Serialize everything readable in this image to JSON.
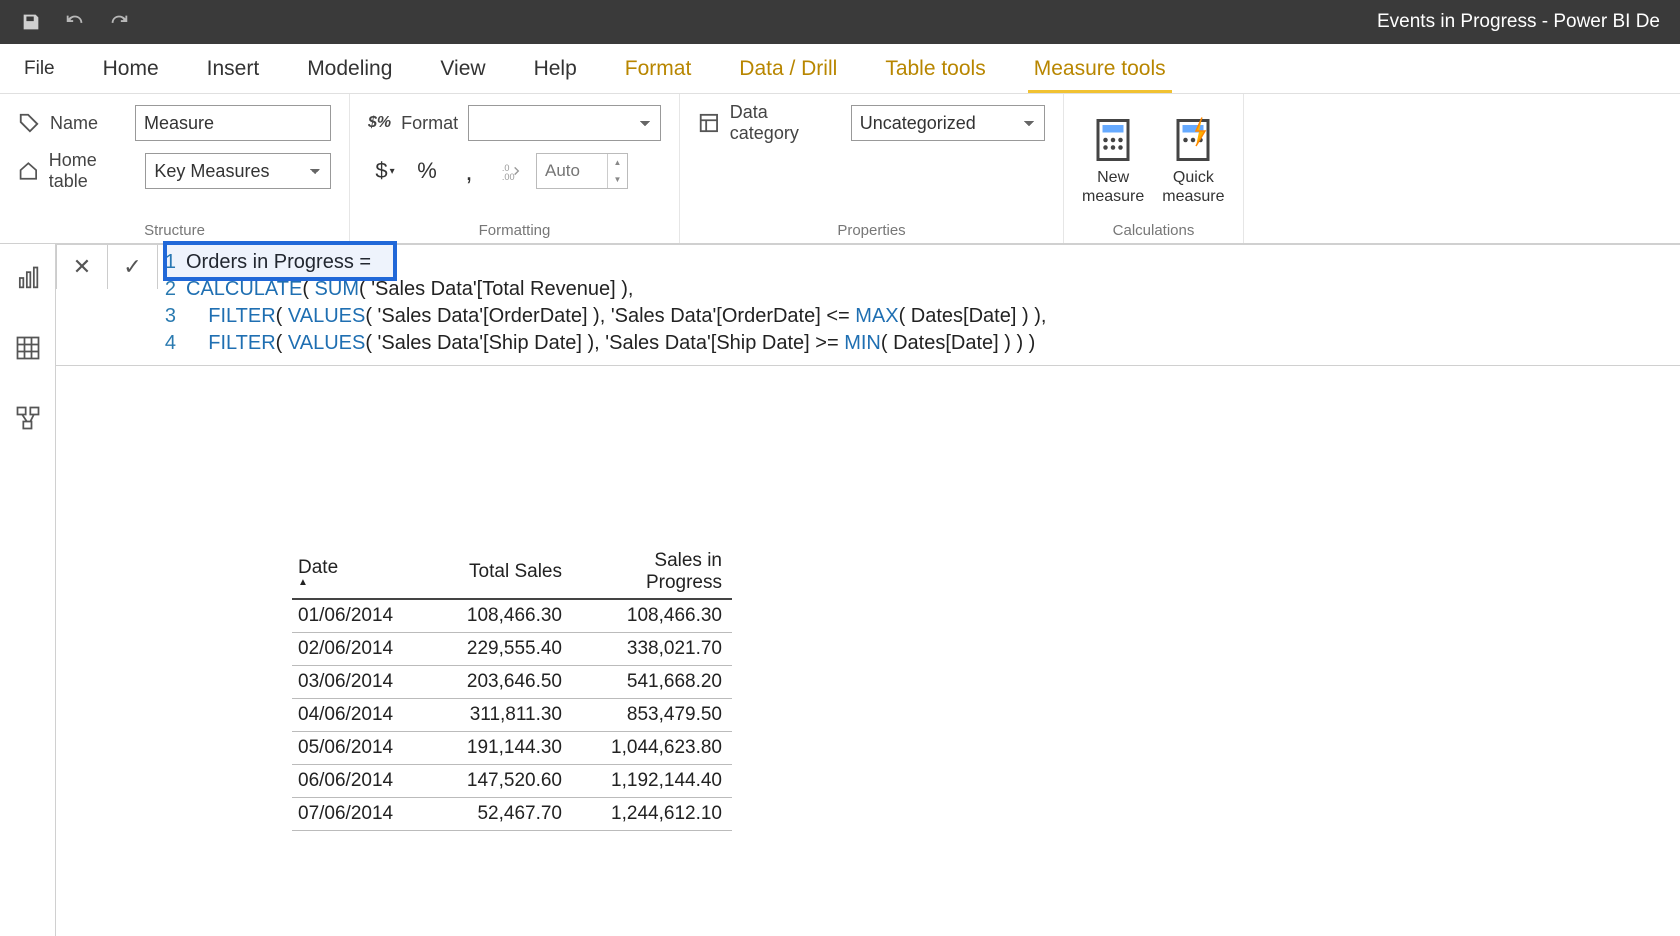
{
  "titlebar": {
    "title": "Events in Progress - Power BI De"
  },
  "tabs": {
    "file": "File",
    "items": [
      "Home",
      "Insert",
      "Modeling",
      "View",
      "Help",
      "Format",
      "Data / Drill",
      "Table tools",
      "Measure tools"
    ],
    "contextual_start": 5,
    "active_index": 8
  },
  "structure": {
    "group_label": "Structure",
    "name_label": "Name",
    "name_value": "Measure",
    "home_table_label": "Home table",
    "home_table_value": "Key Measures"
  },
  "formatting": {
    "group_label": "Formatting",
    "format_label": "Format",
    "format_value": "",
    "decimals_placeholder": "Auto"
  },
  "properties": {
    "group_label": "Properties",
    "data_cat_label": "Data category",
    "data_cat_value": "Uncategorized"
  },
  "calculations": {
    "group_label": "Calculations",
    "new_measure": "New\nmeasure",
    "quick_measure": "Quick\nmeasure"
  },
  "formula": {
    "lines": [
      {
        "n": "1",
        "plain": "Orders in Progress ="
      },
      {
        "n": "2",
        "segments": [
          [
            "fn",
            "CALCULATE"
          ],
          [
            "",
            "( "
          ],
          [
            "fn",
            "SUM"
          ],
          [
            "",
            "( 'Sales Data'[Total Revenue] ),"
          ]
        ]
      },
      {
        "n": "3",
        "segments": [
          [
            "",
            "    "
          ],
          [
            "fn",
            "FILTER"
          ],
          [
            "",
            "( "
          ],
          [
            "fn",
            "VALUES"
          ],
          [
            "",
            "( 'Sales Data'[OrderDate] ), 'Sales Data'[OrderDate] <= "
          ],
          [
            "fn",
            "MAX"
          ],
          [
            "",
            "( Dates[Date] ) ),"
          ]
        ]
      },
      {
        "n": "4",
        "segments": [
          [
            "",
            "    "
          ],
          [
            "fn",
            "FILTER"
          ],
          [
            "",
            "( "
          ],
          [
            "fn",
            "VALUES"
          ],
          [
            "",
            "( 'Sales Data'[Ship Date] ), 'Sales Data'[Ship Date] >= "
          ],
          [
            "fn",
            "MIN"
          ],
          [
            "",
            "( Dates[Date] ) ) )"
          ]
        ]
      }
    ]
  },
  "table": {
    "headers": [
      "Date",
      "Total Sales",
      "Sales in Progress"
    ],
    "rows": [
      [
        "01/06/2014",
        "108,466.30",
        "108,466.30"
      ],
      [
        "02/06/2014",
        "229,555.40",
        "338,021.70"
      ],
      [
        "03/06/2014",
        "203,646.50",
        "541,668.20"
      ],
      [
        "04/06/2014",
        "311,811.30",
        "853,479.50"
      ],
      [
        "05/06/2014",
        "191,144.30",
        "1,044,623.80"
      ],
      [
        "06/06/2014",
        "147,520.60",
        "1,192,144.40"
      ],
      [
        "07/06/2014",
        "52,467.70",
        "1,244,612.10"
      ]
    ]
  }
}
